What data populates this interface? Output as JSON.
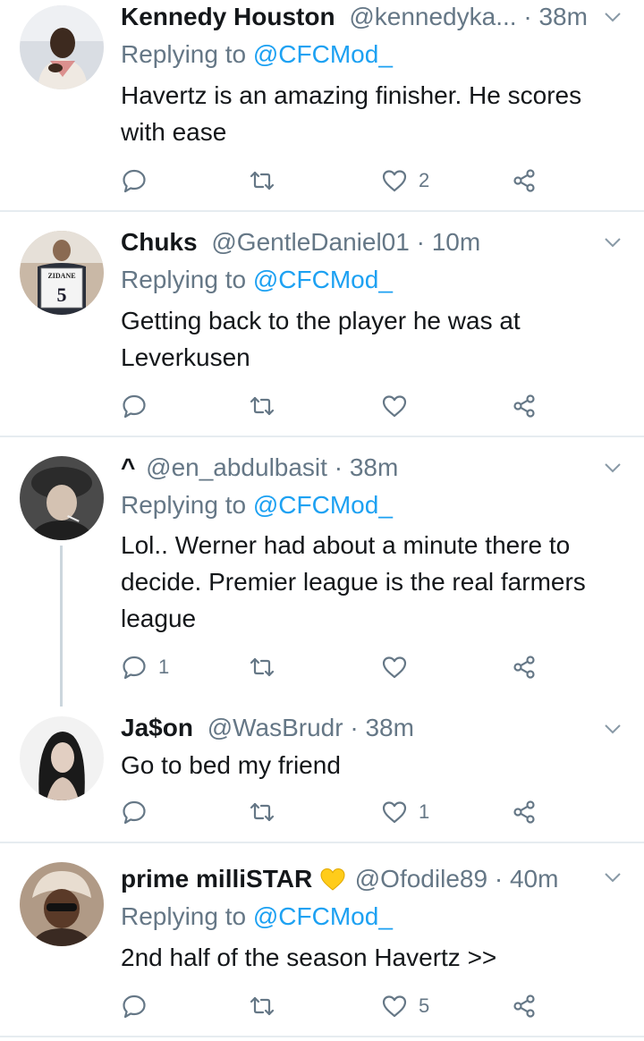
{
  "tweets": [
    {
      "name": "Kennedy Houston",
      "handle": "@kennedyka...",
      "dot": " · ",
      "time": "38m",
      "reply_prefix": "Replying to ",
      "reply_to": "@CFCMod_",
      "text": "Havertz is an amazing finisher. He scores with ease",
      "counts": {
        "reply": "",
        "retweet": "",
        "like": "2"
      }
    },
    {
      "name": "Chuks",
      "handle": "@GentleDaniel01",
      "dot": " · ",
      "time": "10m",
      "reply_prefix": "Replying to ",
      "reply_to": "@CFCMod_",
      "text": "Getting back to the player he was at Leverkusen",
      "counts": {
        "reply": "",
        "retweet": "",
        "like": ""
      }
    },
    {
      "name": "^",
      "handle": "@en_abdulbasit",
      "dot": " · ",
      "time": "38m",
      "reply_prefix": "Replying to ",
      "reply_to": "@CFCMod_",
      "text": "Lol.. Werner had about a minute there to decide. Premier league is the real farmers league",
      "counts": {
        "reply": "1",
        "retweet": "",
        "like": ""
      }
    },
    {
      "name": "Ja$on",
      "handle": "@WasBrudr",
      "dot": " · ",
      "time": "38m",
      "text": "Go to bed my friend",
      "counts": {
        "reply": "",
        "retweet": "",
        "like": "1"
      }
    },
    {
      "name": "prime milliSTAR",
      "handle": "@Ofodile89",
      "dot": " · ",
      "time": "40m",
      "reply_prefix": "Replying to ",
      "reply_to": "@CFCMod_",
      "text": "2nd half of the season Havertz >>",
      "counts": {
        "reply": "",
        "retweet": "",
        "like": "5"
      }
    }
  ],
  "avatar2_jersey": {
    "name": "ZIDANE",
    "number": "5"
  },
  "icons": {
    "reply": "reply-icon",
    "retweet": "retweet-icon",
    "like": "heart-icon",
    "share": "share-icon",
    "chevron": "chevron-down-icon",
    "emoji": "yellow-heart-emoji-icon"
  },
  "colors": {
    "text": "#14171a",
    "muted": "#657786",
    "link": "#1da1f2",
    "divider": "#e6ecf0",
    "emoji": "#ffcc1a"
  }
}
